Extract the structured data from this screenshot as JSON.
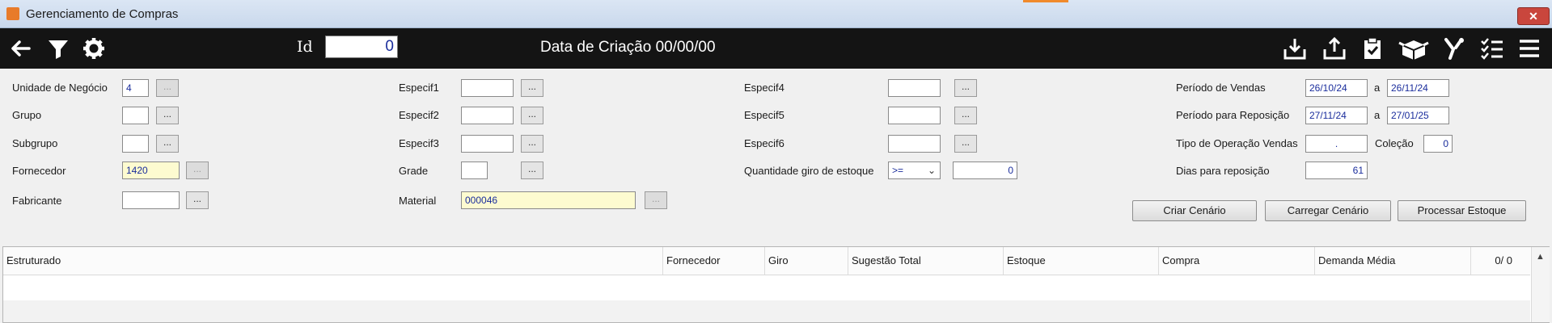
{
  "window": {
    "title": "Gerenciamento de Compras",
    "close_glyph": "✕"
  },
  "toolbar": {
    "icons": [
      "back-arrow-icon",
      "filter-icon",
      "gear-icon",
      "download-icon",
      "upload-icon",
      "clipboard-icon",
      "box-icon",
      "tools-icon",
      "checklist-icon",
      "menu-icon"
    ],
    "id_label": "Id",
    "id_value": "0",
    "created_label": "Data de Criação 00/00/00"
  },
  "form": {
    "unidade": {
      "label": "Unidade de Negócio",
      "value": "4"
    },
    "grupo": {
      "label": "Grupo",
      "value": ""
    },
    "subgrupo": {
      "label": "Subgrupo",
      "value": ""
    },
    "fornecedor": {
      "label": "Fornecedor",
      "value": "1420"
    },
    "fabricante": {
      "label": "Fabricante",
      "value": ""
    },
    "especif1": {
      "label": "Especif1",
      "value": ""
    },
    "especif2": {
      "label": "Especif2",
      "value": ""
    },
    "especif3": {
      "label": "Especif3",
      "value": ""
    },
    "grade": {
      "label": "Grade",
      "value": ""
    },
    "material": {
      "label": "Material",
      "value": "000046"
    },
    "especif4": {
      "label": "Especif4",
      "value": ""
    },
    "especif5": {
      "label": "Especif5",
      "value": ""
    },
    "especif6": {
      "label": "Especif6",
      "value": ""
    },
    "giro": {
      "label": "Quantidade giro de estoque",
      "operator": ">=",
      "value": "0"
    },
    "periodo_vendas": {
      "label": "Período de Vendas",
      "from": "26/10/24",
      "sep": "a",
      "to": "26/11/24"
    },
    "periodo_reposicao": {
      "label": "Período para Reposição",
      "from": "27/11/24",
      "sep": "a",
      "to": "27/01/25"
    },
    "tipo_operacao": {
      "label": "Tipo de Operação Vendas",
      "value": "."
    },
    "colecao": {
      "label": "Coleção",
      "value": "0"
    },
    "dias_reposicao": {
      "label": "Dias para reposição",
      "value": "61"
    },
    "dots": "..."
  },
  "buttons": {
    "criar": "Criar Cenário",
    "carregar": "Carregar Cenário",
    "processar": "Processar Estoque"
  },
  "grid": {
    "columns": [
      "Estruturado",
      "Fornecedor",
      "Giro",
      "Sugestão Total",
      "Estoque",
      "Compra",
      "Demanda Média"
    ],
    "counter": "0/  0"
  }
}
